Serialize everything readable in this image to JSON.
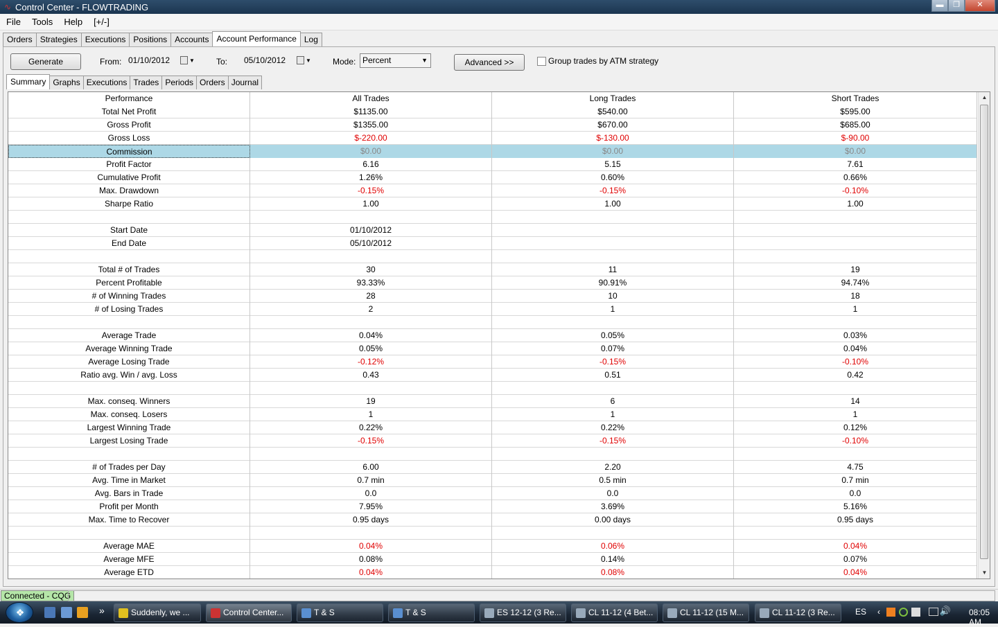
{
  "window": {
    "title": "Control Center - FLOWTRADING",
    "min": "▬",
    "max": "❐",
    "close": "✕"
  },
  "menu": [
    "File",
    "Tools",
    "Help",
    "[+/-]"
  ],
  "main_tabs": [
    "Orders",
    "Strategies",
    "Executions",
    "Positions",
    "Accounts",
    "Account Performance",
    "Log"
  ],
  "controls": {
    "generate": "Generate",
    "from_label": "From:",
    "from_value": "01/10/2012",
    "to_label": "To:",
    "to_value": "05/10/2012",
    "mode_label": "Mode:",
    "mode_value": "Percent",
    "advanced": "Advanced >>",
    "group_label": "Group trades by ATM strategy"
  },
  "sub_tabs": [
    "Summary",
    "Graphs",
    "Executions",
    "Trades",
    "Periods",
    "Orders",
    "Journal"
  ],
  "table": {
    "headers": [
      "Performance",
      "All Trades",
      "Long Trades",
      "Short Trades"
    ],
    "rows": [
      [
        "Total Net Profit",
        "$1135.00",
        "$540.00",
        "$595.00"
      ],
      [
        "Gross Profit",
        "$1355.00",
        "$670.00",
        "$685.00"
      ],
      [
        "Gross Loss",
        "$-220.00",
        "$-130.00",
        "$-90.00"
      ],
      [
        "Commission",
        "$0.00",
        "$0.00",
        "$0.00"
      ],
      [
        "Profit Factor",
        "6.16",
        "5.15",
        "7.61"
      ],
      [
        "Cumulative Profit",
        "1.26%",
        "0.60%",
        "0.66%"
      ],
      [
        "Max. Drawdown",
        "-0.15%",
        "-0.15%",
        "-0.10%"
      ],
      [
        "Sharpe Ratio",
        "1.00",
        "1.00",
        "1.00"
      ],
      [
        "",
        "",
        "",
        ""
      ],
      [
        "Start Date",
        "01/10/2012",
        "",
        ""
      ],
      [
        "End Date",
        "05/10/2012",
        "",
        ""
      ],
      [
        "",
        "",
        "",
        ""
      ],
      [
        "Total # of Trades",
        "30",
        "11",
        "19"
      ],
      [
        "Percent Profitable",
        "93.33%",
        "90.91%",
        "94.74%"
      ],
      [
        "# of Winning Trades",
        "28",
        "10",
        "18"
      ],
      [
        "# of Losing Trades",
        "2",
        "1",
        "1"
      ],
      [
        "",
        "",
        "",
        ""
      ],
      [
        "Average Trade",
        "0.04%",
        "0.05%",
        "0.03%"
      ],
      [
        "Average Winning Trade",
        "0.05%",
        "0.07%",
        "0.04%"
      ],
      [
        "Average Losing Trade",
        "-0.12%",
        "-0.15%",
        "-0.10%"
      ],
      [
        "Ratio avg. Win / avg. Loss",
        "0.43",
        "0.51",
        "0.42"
      ],
      [
        "",
        "",
        "",
        ""
      ],
      [
        "Max. conseq. Winners",
        "19",
        "6",
        "14"
      ],
      [
        "Max. conseq. Losers",
        "1",
        "1",
        "1"
      ],
      [
        "Largest Winning Trade",
        "0.22%",
        "0.22%",
        "0.12%"
      ],
      [
        "Largest Losing Trade",
        "-0.15%",
        "-0.15%",
        "-0.10%"
      ],
      [
        "",
        "",
        "",
        ""
      ],
      [
        "# of Trades per Day",
        "6.00",
        "2.20",
        "4.75"
      ],
      [
        "Avg. Time in Market",
        "0.7 min",
        "0.5 min",
        "0.7 min"
      ],
      [
        "Avg. Bars in Trade",
        "0.0",
        "0.0",
        "0.0"
      ],
      [
        "Profit per Month",
        "7.95%",
        "3.69%",
        "5.16%"
      ],
      [
        "Max. Time to Recover",
        "0.95 days",
        "0.00 days",
        "0.95 days"
      ],
      [
        "",
        "",
        "",
        ""
      ],
      [
        "Average MAE",
        "0.04%",
        "0.06%",
        "0.04%"
      ],
      [
        "Average MFE",
        "0.08%",
        "0.14%",
        "0.07%"
      ],
      [
        "Average ETD",
        "0.04%",
        "0.08%",
        "0.04%"
      ]
    ],
    "selected_row": 3,
    "red_rows": [
      2,
      6,
      19,
      25,
      33,
      35
    ]
  },
  "status": {
    "connection": "Connected - CQG"
  },
  "taskbar": {
    "more": "»",
    "buttons": [
      {
        "label": "Suddenly, we ...",
        "icon": "chrome-icon"
      },
      {
        "label": "Control Center...",
        "icon": "ninjatrader-icon"
      },
      {
        "label": "T & S",
        "icon": "grid-icon"
      },
      {
        "label": "T & S",
        "icon": "grid-icon"
      },
      {
        "label": "ES 12-12 (3 Re...",
        "icon": "chart-icon"
      },
      {
        "label": "CL 11-12 (4 Bet...",
        "icon": "chart-icon"
      },
      {
        "label": "CL 11-12 (15 M...",
        "icon": "chart-icon"
      },
      {
        "label": "CL 11-12 (3 Re...",
        "icon": "chart-icon"
      }
    ],
    "lang": "ES",
    "time": "08:05 AM"
  },
  "colors": {
    "selected_row": "#add8e6",
    "negative": "#e00000",
    "connected": "#b5e6a8"
  }
}
